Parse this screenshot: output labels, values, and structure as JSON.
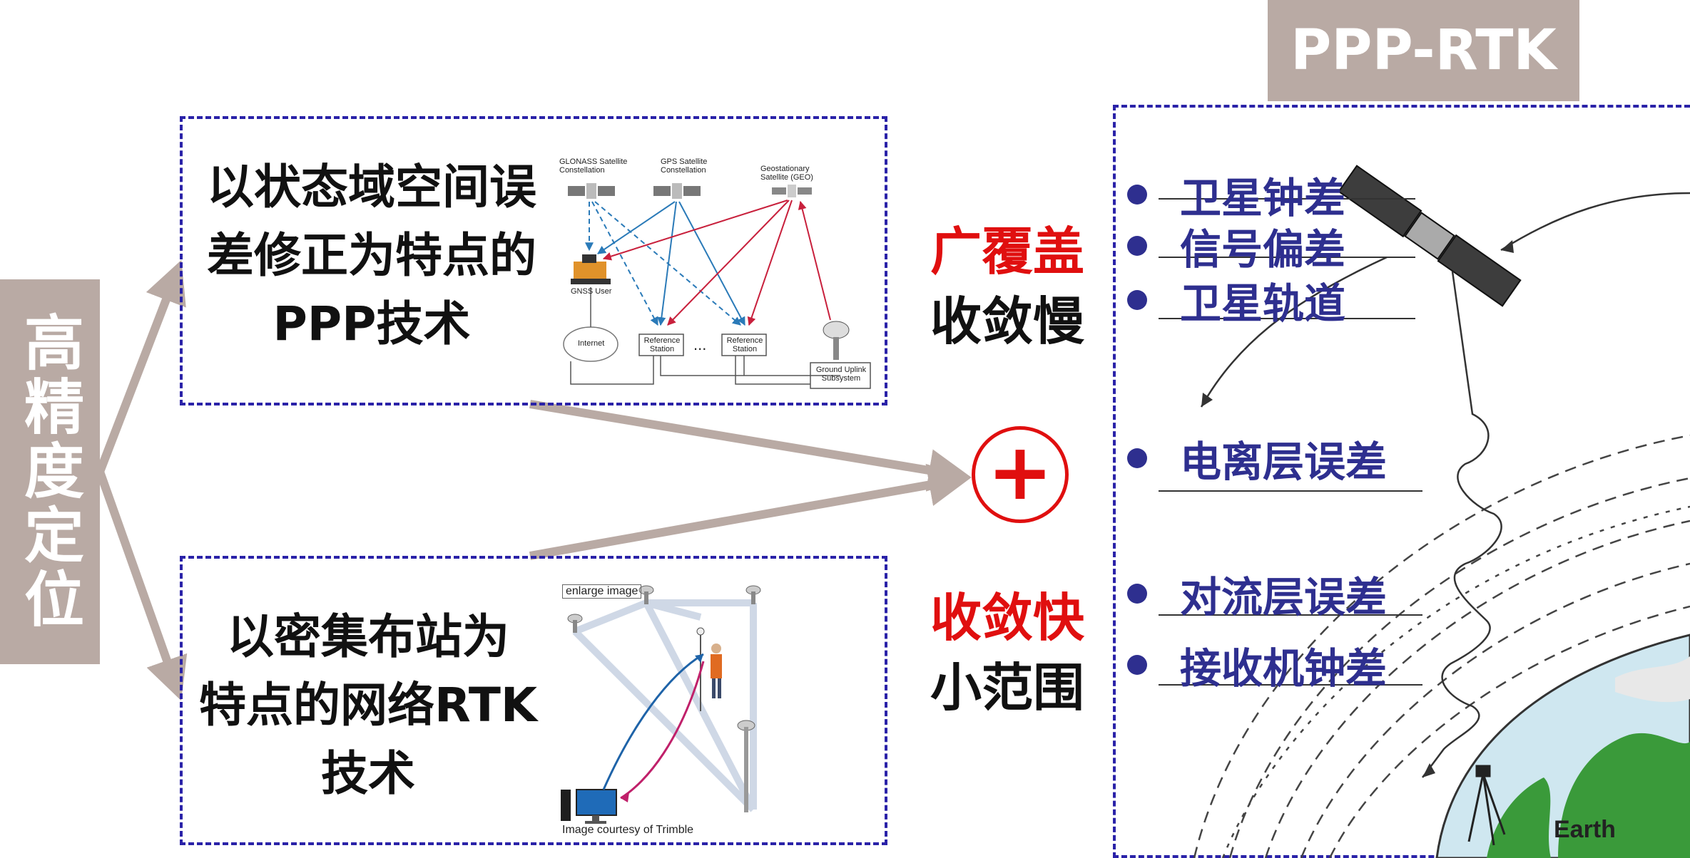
{
  "side_label": "高精度定位",
  "ppp_box": {
    "lines": [
      "以状态域空间误",
      "差修正为特点的",
      "PPP技术"
    ]
  },
  "rtk_box": {
    "lines": [
      "以密集布站为",
      "特点的网络RTK",
      "技术"
    ]
  },
  "ppp_diagram": {
    "glonass": "GLONASS Satellite Constellation",
    "gps": "GPS Satellite Constellation",
    "geo": "Geostationary Satellite (GEO)",
    "user": "GNSS User",
    "internet": "Internet",
    "ref1": "Reference Station",
    "ref2": "Reference Station",
    "ellipsis": "...",
    "uplink": "Ground Uplink Subsystem"
  },
  "rtk_diagram": {
    "enlarge": "enlarge image",
    "courtesy": "Image courtesy of Trimble"
  },
  "compare": {
    "ppp": {
      "pro": "广覆盖",
      "con": "收敛慢"
    },
    "rtk": {
      "pro": "收敛快",
      "con": "小范围"
    }
  },
  "plus_symbol": "+",
  "right_panel": {
    "title": "PPP-RTK",
    "errors": [
      "卫星钟差",
      "信号偏差",
      "卫星轨道",
      "电离层误差",
      "对流层误差",
      "接收机钟差"
    ],
    "earth_label": "Earth"
  },
  "colors": {
    "accent_box": "#b9aaa4",
    "dash_border": "#2a22a8",
    "error_text": "#2e2f8f",
    "highlight_red": "#e00f0f"
  }
}
